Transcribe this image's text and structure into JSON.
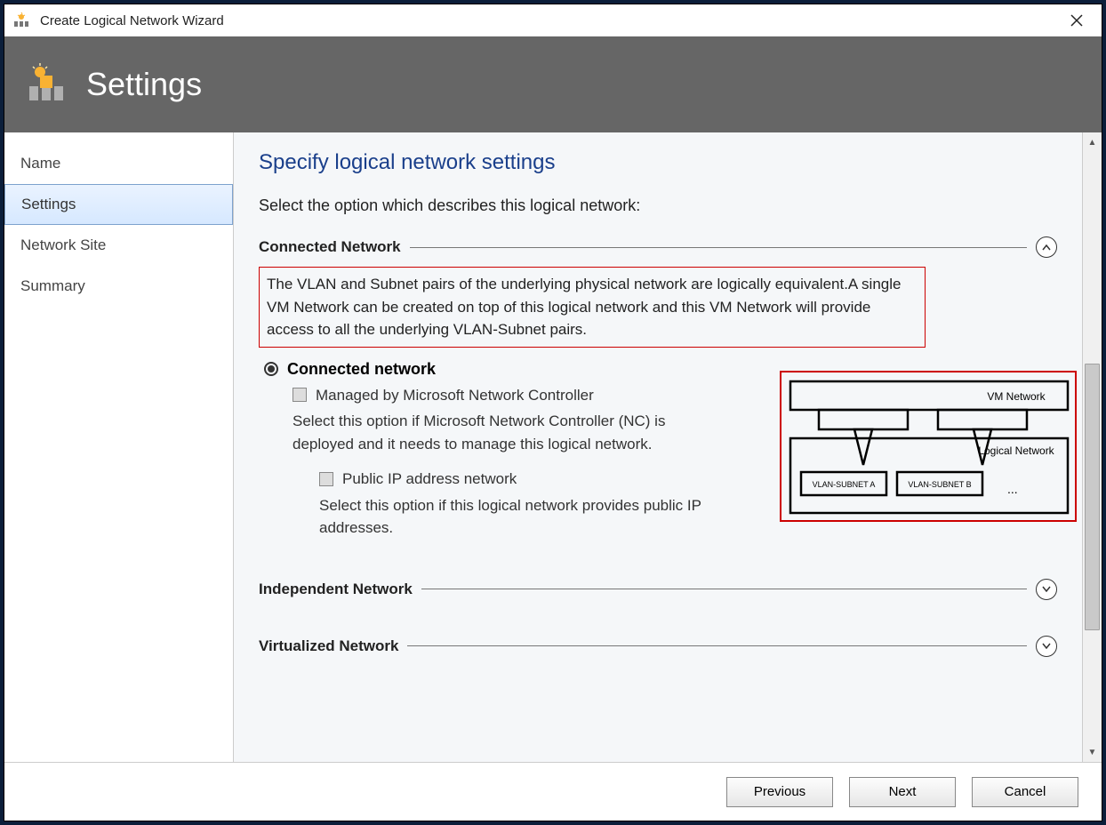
{
  "window": {
    "title": "Create Logical Network Wizard"
  },
  "banner": {
    "title": "Settings"
  },
  "sidebar": {
    "items": [
      {
        "label": "Name"
      },
      {
        "label": "Settings"
      },
      {
        "label": "Network Site"
      },
      {
        "label": "Summary"
      }
    ]
  },
  "content": {
    "heading": "Specify logical network settings",
    "lead": "Select the option which describes this logical network:",
    "groups": {
      "connected": {
        "title": "Connected Network",
        "description": "The VLAN and Subnet pairs of the underlying physical network are logically equivalent.A single VM Network can be created on top of this logical network and this VM Network will provide access to all the underlying VLAN-Subnet pairs.",
        "radio_label": "Connected network",
        "managed_label": "Managed by Microsoft Network Controller",
        "managed_desc": "Select this option if Microsoft Network Controller (NC) is deployed and it needs to manage this logical network.",
        "publicip_label": "Public IP address network",
        "publicip_desc": "Select this option if this logical network provides public IP addresses.",
        "diagram": {
          "vm_network": "VM Network",
          "logical_network": "Logical Network",
          "vlan_a": "VLAN-SUBNET A",
          "vlan_b": "VLAN-SUBNET B",
          "dots": "..."
        }
      },
      "independent": {
        "title": "Independent Network"
      },
      "virtualized": {
        "title": "Virtualized Network"
      }
    }
  },
  "footer": {
    "previous": "Previous",
    "next": "Next",
    "cancel": "Cancel"
  }
}
